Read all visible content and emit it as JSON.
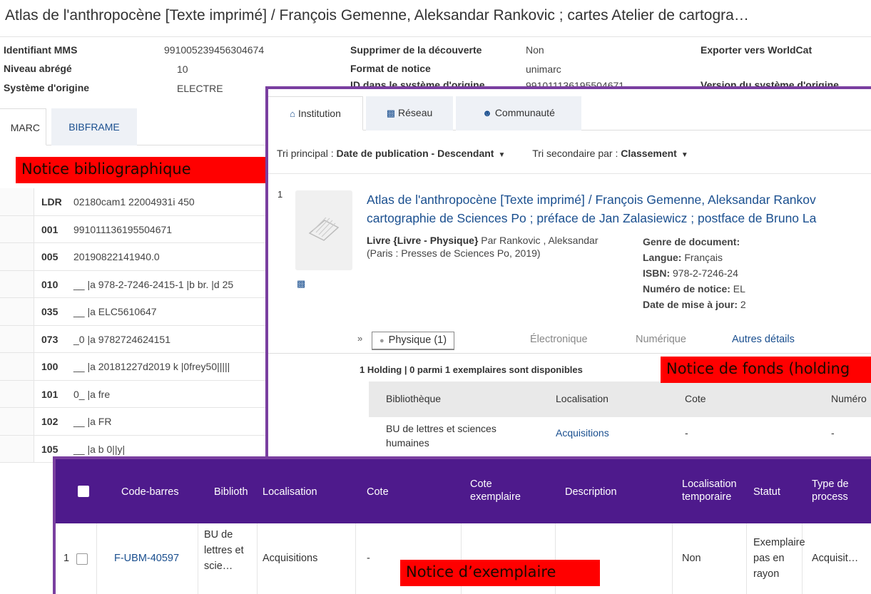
{
  "record": {
    "title": "Atlas de l'anthropocène [Texte imprimé] / François Gemenne, Aleksandar Rankovic ; cartes Atelier de cartogra…",
    "meta": {
      "mms_label": "Identifiant MMS",
      "mms_value": "991005239456304674",
      "level_label": "Niveau abrégé",
      "level_value": "10",
      "system_label": "Système d'origine",
      "system_value": "ELECTRE",
      "discovery_label": "Supprimer de la découverte",
      "discovery_value": "Non",
      "format_label": "Format de notice",
      "format_value": "unimarc",
      "sysid_label": "ID dans le système d'origine",
      "sysid_value": "991011136195504671",
      "worldcat_label": "Exporter vers WorldCat",
      "version_label": "Version du système d'origine"
    },
    "tabs": {
      "marc": "MARC",
      "bibframe": "BIBFRAME"
    },
    "marc_fields": [
      {
        "tag": "LDR",
        "value": "02180cam1 22004931i 450"
      },
      {
        "tag": "001",
        "value": "991011136195504671"
      },
      {
        "tag": "005",
        "value": "20190822141940.0"
      },
      {
        "tag": "010",
        "value": "__ |a 978-2-7246-2415-1 |b br. |d 25"
      },
      {
        "tag": "035",
        "value": "__ |a ELC5610647"
      },
      {
        "tag": "073",
        "value": "_0 |a 9782724624151"
      },
      {
        "tag": "100",
        "value": "__ |a 20181227d2019 k |0frey50|||||"
      },
      {
        "tag": "101",
        "value": "0_ |a fre"
      },
      {
        "tag": "102",
        "value": "__ |a FR"
      },
      {
        "tag": "105",
        "value": "__ |a b 0||y|"
      }
    ]
  },
  "labels": {
    "bib": "Notice bibliographique",
    "holding": "Notice de fonds (holding",
    "item": "Notice d’exemplaire"
  },
  "search": {
    "tabs": {
      "institution": "Institution",
      "reseau": "Réseau",
      "communaute": "Communauté"
    },
    "sort_primary_label": "Tri principal :",
    "sort_primary_value": "Date de publication - Descendant",
    "sort_secondary_label": "Tri secondaire par :",
    "sort_secondary_value": "Classement",
    "result": {
      "number": "1",
      "title_line1": "Atlas de l'anthropocène [Texte imprimé] / François Gemenne, Aleksandar Rankov",
      "title_line2": "cartographie de Sciences Po ; préface de Jan Zalasiewicz ; postface de Bruno La",
      "type": "Livre {Livre - Physique}",
      "by": " Par Rankovic , Aleksandar (Paris : Presses de Sciences Po, 2019)",
      "genre_label": "Genre de document:",
      "genre_value": " ",
      "langue_label": "Langue:",
      "langue_value": " Français",
      "isbn_label": "ISBN:",
      "isbn_value": " 978-2-7246-24",
      "notice_label": "Numéro de notice:",
      "notice_value": " EL",
      "maj_label": "Date de mise à jour:",
      "maj_value": " 2"
    },
    "availability": {
      "physique": "Physique (1)",
      "electronique": "Électronique",
      "numerique": "Numérique",
      "autres": "Autres détails"
    },
    "holding_summary": "1 Holding | 0 parmi 1 exemplaires sont disponibles",
    "holding_headers": {
      "bibliotheque": "Bibliothèque",
      "localisation": "Localisation",
      "cote": "Cote",
      "numero": "Numéro"
    },
    "holding_row": {
      "bibliotheque": "BU de lettres et sciences humaines",
      "localisation": "Acquisitions",
      "cote": "-",
      "numero": "-"
    }
  },
  "items": {
    "headers": {
      "barcode": "Code-barres",
      "biblio": "Biblioth",
      "localisation": "Localisation",
      "cote": "Cote",
      "cote_ex": "Cote exemplaire",
      "description": "Description",
      "loc_temp": "Localisation temporaire",
      "statut": "Statut",
      "type_proc": "Type de process"
    },
    "row": {
      "num": "1",
      "barcode": "F-UBM-40597",
      "biblio": "BU de lettres et scie…",
      "localisation": "Acquisitions",
      "cote": "-",
      "loc_temp": "Non",
      "statut": "Exemplaire pas en rayon",
      "type_proc": "Acquisit…"
    }
  },
  "colors": {
    "accent": "#7a3fa0",
    "header_purple": "#4e1a8c",
    "link": "#1a4f8f",
    "label_red": "#ff0000"
  },
  "icons": {
    "institution": "home-icon",
    "reseau": "network-icon",
    "communaute": "users-icon"
  }
}
